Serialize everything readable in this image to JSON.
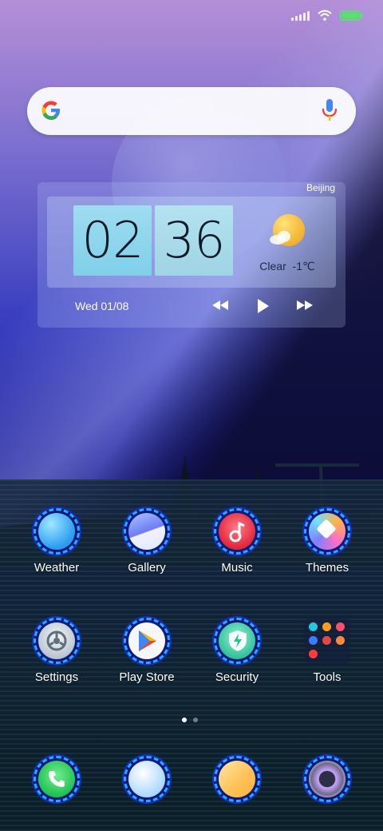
{
  "status_bar": {
    "signal_icon": "cellular-signal-icon",
    "wifi_icon": "wifi-icon",
    "battery_icon": "battery-charging-icon",
    "battery_color": "#57e36b"
  },
  "search": {
    "logo": "google-g-icon",
    "mic": "microphone-icon"
  },
  "widget": {
    "city": "Beijing",
    "hours": "02",
    "minutes": "36",
    "weather": "Clear  -1℃",
    "weather_icon": "partly-sunny-icon",
    "date": "Wed 01/08",
    "controls": [
      "previous-icon",
      "play-icon",
      "next-icon"
    ]
  },
  "apps": {
    "row1": [
      {
        "label": "Weather",
        "icon": "weather-app-icon"
      },
      {
        "label": "Gallery",
        "icon": "gallery-app-icon"
      },
      {
        "label": "Music",
        "icon": "music-app-icon"
      },
      {
        "label": "Themes",
        "icon": "themes-app-icon"
      }
    ],
    "row2": [
      {
        "label": "Settings",
        "icon": "settings-app-icon"
      },
      {
        "label": "Play Store",
        "icon": "play-store-app-icon"
      },
      {
        "label": "Security",
        "icon": "security-app-icon"
      },
      {
        "label": "Tools",
        "icon": "tools-folder-icon"
      }
    ]
  },
  "page_indicator": {
    "pages": 2,
    "current": 1
  },
  "dock": [
    "phone-app-icon",
    "messages-app-icon",
    "notes-app-icon",
    "camera-app-icon"
  ],
  "colors": {
    "accent_ring": "#2aa9ff",
    "widget_digit_bg": "#8fd6ec"
  }
}
